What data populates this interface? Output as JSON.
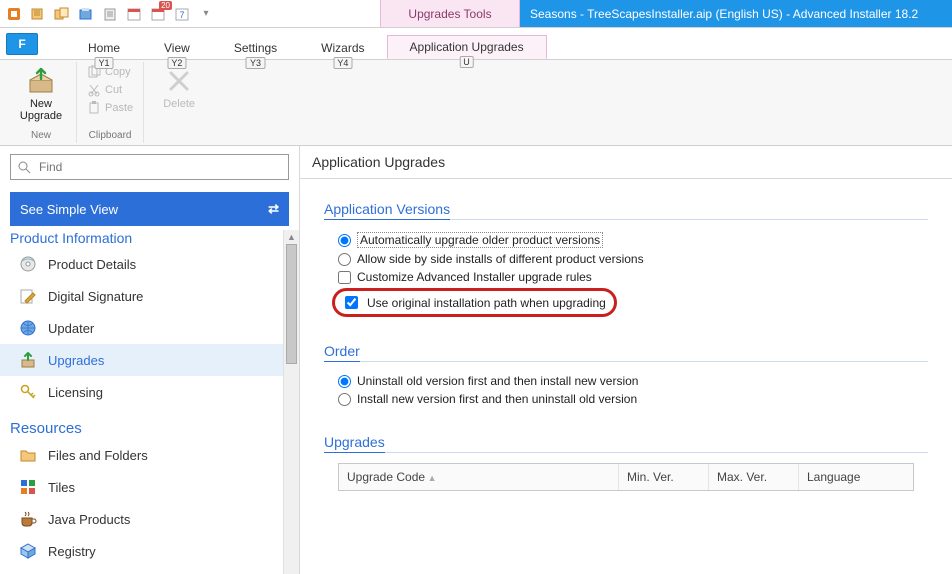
{
  "titlebar": {
    "tool_tab": "Upgrades Tools",
    "title": "Seasons - TreeScapesInstaller.aip (English US) - Advanced Installer 18.2",
    "qat_badge": "20"
  },
  "tabs": {
    "file": "F",
    "items": [
      {
        "label": "Home",
        "key": "Y1"
      },
      {
        "label": "View",
        "key": "Y2"
      },
      {
        "label": "Settings",
        "key": "Y3"
      },
      {
        "label": "Wizards",
        "key": "Y4"
      },
      {
        "label": "Application Upgrades",
        "key": "U",
        "active": true
      }
    ]
  },
  "ribbon": {
    "new_upgrade": "New Upgrade",
    "group_new": "New",
    "copy": "Copy",
    "cut": "Cut",
    "paste": "Paste",
    "group_clipboard": "Clipboard",
    "delete": "Delete"
  },
  "left": {
    "find_placeholder": "Find",
    "simple_view": "See Simple View",
    "section_product_info": "Product Information",
    "items_product": [
      "Product Details",
      "Digital Signature",
      "Updater",
      "Upgrades",
      "Licensing"
    ],
    "section_resources": "Resources",
    "items_resources": [
      "Files and Folders",
      "Tiles",
      "Java Products",
      "Registry"
    ]
  },
  "page": {
    "header": "Application Upgrades",
    "group_versions": "Application Versions",
    "opt_auto": "Automatically upgrade older product versions",
    "opt_sidebyside": "Allow side by side installs of different product versions",
    "opt_customize": "Customize Advanced Installer upgrade rules",
    "opt_origpath": "Use original installation path when upgrading",
    "group_order": "Order",
    "order_uninstall_first": "Uninstall old version first and then install new version",
    "order_install_first": "Install new version first and then uninstall old version",
    "group_upgrades": "Upgrades",
    "cols": {
      "code": "Upgrade Code",
      "minver": "Min. Ver.",
      "maxver": "Max. Ver.",
      "lang": "Language"
    }
  }
}
